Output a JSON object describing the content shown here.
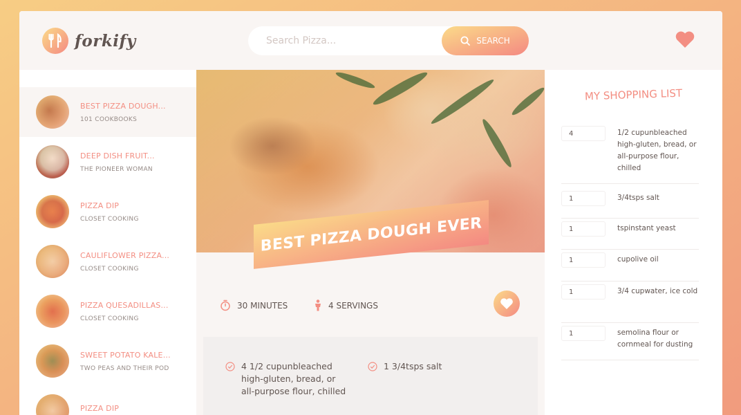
{
  "header": {
    "logo_text": "forkify",
    "search_placeholder": "Search Pizza...",
    "search_button": "Search"
  },
  "results": [
    {
      "title": "BEST PIZZA DOUGH...",
      "author": "101 COOKBOOKS",
      "active": true
    },
    {
      "title": "DEEP DISH FRUIT...",
      "author": "THE PIONEER WOMAN"
    },
    {
      "title": "PIZZA DIP",
      "author": "CLOSET COOKING"
    },
    {
      "title": "CAULIFLOWER PIZZA...",
      "author": "CLOSET COOKING"
    },
    {
      "title": "PIZZA QUESADILLAS...",
      "author": "CLOSET COOKING"
    },
    {
      "title": "SWEET POTATO KALE...",
      "author": "TWO PEAS AND THEIR POD"
    },
    {
      "title": "PIZZA DIP",
      "author": ""
    }
  ],
  "recipe": {
    "title": "BEST PIZZA DOUGH EVER",
    "time": "30 MINUTES",
    "servings": "4 SERVINGS",
    "ingredients": [
      "4 1/2 cupunbleached high-gluten, bread, or all-purpose flour, chilled",
      "1 3/4tsps salt"
    ]
  },
  "shopping": {
    "heading": "MY SHOPPING LIST",
    "items": [
      {
        "qty": "4",
        "desc": "1/2 cupunbleached high-gluten, bread, or all-purpose flour, chilled"
      },
      {
        "qty": "1",
        "desc": "3/4tsps salt"
      },
      {
        "qty": "1",
        "desc": "tspinstant yeast"
      },
      {
        "qty": "1",
        "desc": "cupolive oil"
      },
      {
        "qty": "1",
        "desc": "3/4 cupwater, ice cold"
      },
      {
        "qty": "1",
        "desc": "semolina flour or cornmeal for dusting"
      }
    ]
  },
  "colors": {
    "accent": "#f38e82",
    "accent_light": "#fbdb89",
    "text": "#615551"
  },
  "icons": [
    "fork-knife-icon",
    "search-icon",
    "heart-icon",
    "stopwatch-icon",
    "person-icon",
    "check-circle-icon"
  ]
}
